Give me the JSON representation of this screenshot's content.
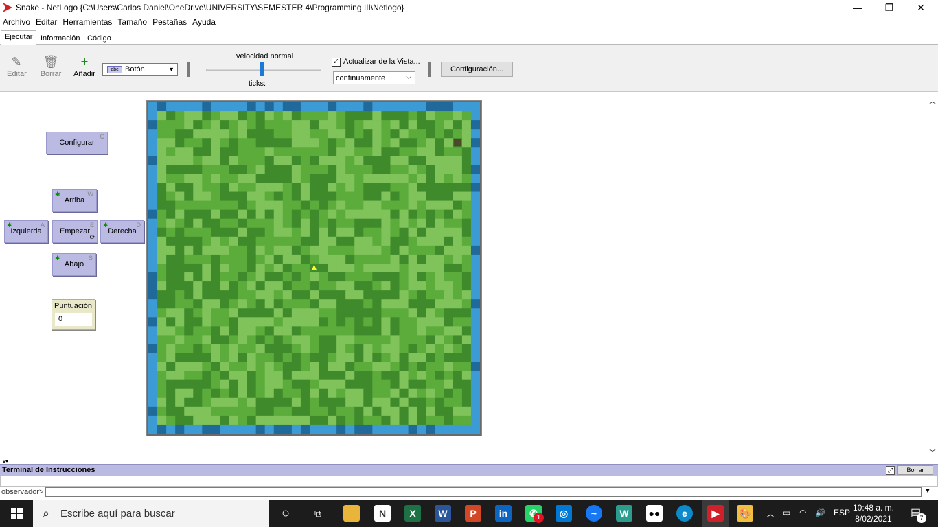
{
  "window": {
    "title": "Snake - NetLogo {C:\\Users\\Carlos Daniel\\OneDrive\\UNIVERSITY\\SEMESTER 4\\Programming III\\Netlogo}",
    "minimize": "—",
    "maximize": "❐",
    "close": "✕"
  },
  "menu": [
    "Archivo",
    "Editar",
    "Herramientas",
    "Tamaño",
    "Pestañas",
    "Ayuda"
  ],
  "tabs": [
    "Ejecutar",
    "Información",
    "Código"
  ],
  "toolbar": {
    "edit_label": "Editar",
    "delete_label": "Borrar",
    "add_label": "Añadir",
    "widget_type": "Botón",
    "widget_icon_text": "abc",
    "speed_label": "velocidad normal",
    "ticks_label": "ticks:",
    "view_updates_label": "Actualizar de la Vista...",
    "view_updates_checked": true,
    "update_mode": "continuamente",
    "settings_label": "Configuración..."
  },
  "buttons": {
    "setup": {
      "label": "Configurar",
      "key": "C"
    },
    "up": {
      "label": "Arriba",
      "key": "W"
    },
    "left": {
      "label": "Izquierda",
      "key": "A"
    },
    "start": {
      "label": "Empezar",
      "key": "E"
    },
    "right": {
      "label": "Derecha",
      "key": "D"
    },
    "down": {
      "label": "Abajo",
      "key": "S"
    }
  },
  "monitor": {
    "label": "Puntuación",
    "value": "0"
  },
  "terminal": {
    "title": "Terminal de Instrucciones",
    "clear_label": "Borrar",
    "prompt": "observador>"
  },
  "taskbar": {
    "search_placeholder": "Escribe aquí para buscar",
    "whatsapp_badge": "1",
    "language": "ESP",
    "time": "10:48 a. m.",
    "date": "8/02/2021",
    "notifications": "7"
  },
  "colors": {
    "grass_light": "#7fc35a",
    "grass_mid": "#5cac3c",
    "grass_dark": "#3f8b2c",
    "water_light": "#3c9bd4",
    "water_dark": "#1f6a9a",
    "button_bg": "#babae3",
    "monitor_bg": "#e9e9c9",
    "snake_head": "#ffff33"
  }
}
